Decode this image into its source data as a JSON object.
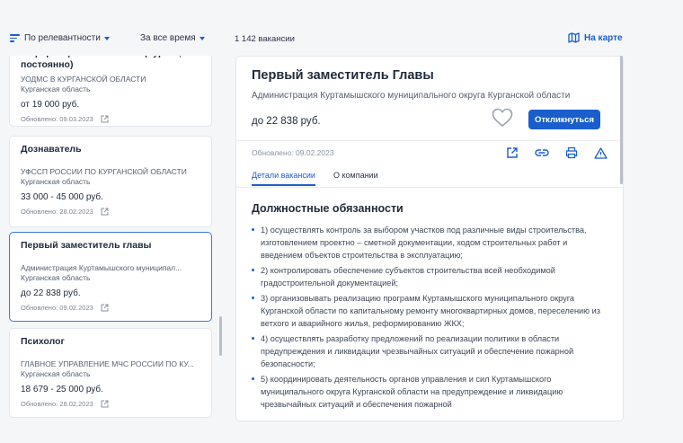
{
  "toolbar": {
    "sort_label": "По релевантности",
    "period_label": "За все время",
    "count_label": "1 142 вакансии",
    "map_label": "На карте"
  },
  "vacancies": [
    {
      "title": "информационных систем (Курган, постоянно)",
      "org": "УОДМС В КУРГАНСКОЙ ОБЛАСТИ",
      "region": "Курганская область",
      "salary": "от 19 000 руб.",
      "updated": "Обновлено: 09.03.2023"
    },
    {
      "title": "Дознаватель",
      "org": "УФССП РОССИИ ПО КУРГАНСКОЙ ОБЛАСТИ",
      "region": "Курганская область",
      "salary": "33 000 - 45 000 руб.",
      "updated": "Обновлено: 28.02.2023"
    },
    {
      "title": "Первый заместитель главы",
      "org": "Администрация Куртамышского муниципал...",
      "region": "Курганская область",
      "salary": "до 22 838 руб.",
      "updated": "Обновлено: 09.02.2023"
    },
    {
      "title": "Психолог",
      "org": "ГЛАВНОЕ УПРАВЛЕНИЕ МЧС РОССИИ ПО КУ...",
      "region": "Курганская область",
      "salary": "18 679 - 25 000 руб.",
      "updated": "Обновлено: 28.02.2023"
    }
  ],
  "detail": {
    "title": "Первый заместитель Главы",
    "org": "Администрация Куртамышского муниципального округа Курганской области",
    "salary": "до 22 838 руб.",
    "respond_label": "Откликнуться",
    "updated": "Обновлено: 09.02.2023",
    "tabs": [
      "Детали вакансии",
      "О компании"
    ],
    "section_title": "Должностные обязанности",
    "duties": [
      "1) осуществлять контроль за выбором участков под различные виды строительства, изготовлением проектно – сметной документации, ходом строительных работ и введением объектов строительства в эксплуатацию;",
      "2) контролировать обеспечение субъектов строительства всей необходимой градостроительной документацией;",
      "3) организовывать реализацию программ Куртамышского муниципального округа Курганской области по капитальному ремонту многоквартирных домов, переселению из ветхого и аварийного жилья, реформированию ЖКХ;",
      "4) осуществлять разработку предложений по реализации политики в области предупреждения и ликвидации чрезвычайных ситуаций и обеспечение пожарной безопасности;",
      "5) координировать деятельность органов управления и сил Куртамышского муниципального округа Курганской области на предупреждение и ликвидацию чрезвычайных ситуаций и обеспечения пожарной"
    ]
  },
  "icons": [
    "sort-icon",
    "map-icon",
    "external-link-icon",
    "heart-icon",
    "share-icon",
    "link-icon",
    "print-icon",
    "warning-icon"
  ],
  "colors": {
    "accent": "#1a5ecb",
    "background": "#f5f6f8"
  }
}
